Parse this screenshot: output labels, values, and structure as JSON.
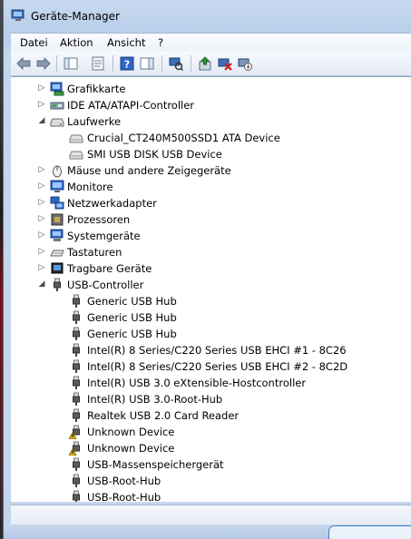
{
  "window": {
    "title": "Geräte-Manager"
  },
  "menu": [
    "Datei",
    "Aktion",
    "Ansicht",
    "?"
  ],
  "toolbar": [
    {
      "name": "back-icon"
    },
    {
      "name": "forward-icon"
    },
    {
      "name": "console-tree-icon"
    },
    {
      "name": "properties-icon"
    },
    {
      "name": "help-icon"
    },
    {
      "name": "action-pane-icon"
    },
    {
      "name": "scan-hardware-icon"
    },
    {
      "name": "update-driver-icon"
    },
    {
      "name": "uninstall-icon"
    },
    {
      "name": "disable-icon"
    }
  ],
  "tree": [
    {
      "label": "Grafikkarte",
      "level": 1,
      "expander": "collapsed",
      "icon": "display-adapter-icon"
    },
    {
      "label": "IDE ATA/ATAPI-Controller",
      "level": 1,
      "expander": "collapsed",
      "icon": "ide-controller-icon"
    },
    {
      "label": "Laufwerke",
      "level": 1,
      "expander": "expanded",
      "icon": "drives-icon"
    },
    {
      "label": "Crucial_CT240M500SSD1 ATA Device",
      "level": 2,
      "expander": "none",
      "icon": "disk-drive-icon"
    },
    {
      "label": "SMI USB DISK USB Device",
      "level": 2,
      "expander": "none",
      "icon": "disk-drive-icon"
    },
    {
      "label": "Mäuse und andere Zeigegeräte",
      "level": 1,
      "expander": "collapsed",
      "icon": "mouse-icon"
    },
    {
      "label": "Monitore",
      "level": 1,
      "expander": "collapsed",
      "icon": "monitor-icon"
    },
    {
      "label": "Netzwerkadapter",
      "level": 1,
      "expander": "collapsed",
      "icon": "network-adapter-icon"
    },
    {
      "label": "Prozessoren",
      "level": 1,
      "expander": "collapsed",
      "icon": "processor-icon"
    },
    {
      "label": "Systemgeräte",
      "level": 1,
      "expander": "collapsed",
      "icon": "system-devices-icon"
    },
    {
      "label": "Tastaturen",
      "level": 1,
      "expander": "collapsed",
      "icon": "keyboard-icon"
    },
    {
      "label": "Tragbare Geräte",
      "level": 1,
      "expander": "collapsed",
      "icon": "portable-devices-icon"
    },
    {
      "label": "USB-Controller",
      "level": 1,
      "expander": "expanded",
      "icon": "usb-icon"
    },
    {
      "label": "Generic USB Hub",
      "level": 2,
      "expander": "none",
      "icon": "usb-icon"
    },
    {
      "label": "Generic USB Hub",
      "level": 2,
      "expander": "none",
      "icon": "usb-icon"
    },
    {
      "label": "Generic USB Hub",
      "level": 2,
      "expander": "none",
      "icon": "usb-icon"
    },
    {
      "label": "Intel(R) 8 Series/C220 Series USB EHCI #1 - 8C26",
      "level": 2,
      "expander": "none",
      "icon": "usb-icon"
    },
    {
      "label": "Intel(R) 8 Series/C220 Series USB EHCI #2 - 8C2D",
      "level": 2,
      "expander": "none",
      "icon": "usb-icon"
    },
    {
      "label": "Intel(R) USB 3.0 eXtensible-Hostcontroller",
      "level": 2,
      "expander": "none",
      "icon": "usb-icon"
    },
    {
      "label": "Intel(R) USB 3.0-Root-Hub",
      "level": 2,
      "expander": "none",
      "icon": "usb-icon"
    },
    {
      "label": "Realtek USB 2.0 Card Reader",
      "level": 2,
      "expander": "none",
      "icon": "usb-icon"
    },
    {
      "label": "Unknown Device",
      "level": 2,
      "expander": "none",
      "icon": "usb-warning-icon"
    },
    {
      "label": "Unknown Device",
      "level": 2,
      "expander": "none",
      "icon": "usb-warning-icon"
    },
    {
      "label": "USB-Massenspeichergerät",
      "level": 2,
      "expander": "none",
      "icon": "usb-icon"
    },
    {
      "label": "USB-Root-Hub",
      "level": 2,
      "expander": "none",
      "icon": "usb-icon"
    },
    {
      "label": "USB-Root-Hub",
      "level": 2,
      "expander": "none",
      "icon": "usb-icon"
    }
  ],
  "status": {
    "text": ""
  },
  "colors": {
    "warning": "#f2c200",
    "window_frame": "#b6cde9"
  }
}
